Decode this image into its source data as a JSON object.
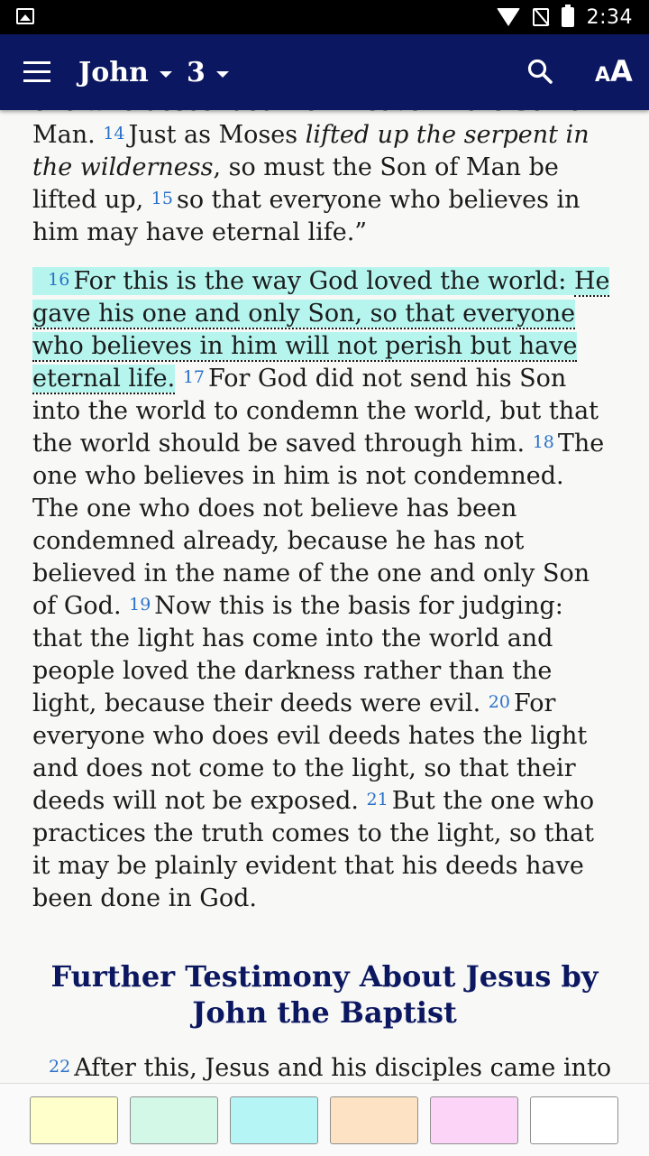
{
  "status_bar": {
    "time": "2:34"
  },
  "app_bar": {
    "book": "John",
    "chapter": "3"
  },
  "passage": {
    "top_line": "one who descended from heaven – the Son of",
    "p1": [
      {
        "text": "Man. "
      },
      {
        "verse": "14"
      },
      {
        "text": "Just as Moses "
      },
      {
        "italic": "lifted up the serpent in the wilderness"
      },
      {
        "text": ", so must the Son of Man be lifted up, "
      },
      {
        "verse": "15"
      },
      {
        "text": "so that everyone who believes in him may have eternal life.”"
      }
    ],
    "v16": "16",
    "v16_text": "For this is the way God loved the world: ",
    "v16_underlined": "He gave his one and only Son, so that everyone who believes in him will not perish but have eternal life.",
    "rest": [
      {
        "text": " "
      },
      {
        "verse": "17"
      },
      {
        "text": "For God did not send his Son into the world to condemn the world, but that the world should be saved through him. "
      },
      {
        "verse": "18"
      },
      {
        "text": "The one who believes in him is not condemned. The one who does not believe has been condemned already, because he has not believed in the name of the one and only Son of God. "
      },
      {
        "verse": "19"
      },
      {
        "text": "Now this is the basis for judging: that the light has come into the world and people loved the darkness rather than the light, because their deeds were evil. "
      },
      {
        "verse": "20"
      },
      {
        "text": "For everyone who does evil deeds hates the light and does not come to the light, so that their deeds will not be exposed. "
      },
      {
        "verse": "21"
      },
      {
        "text": "But the one who practices the truth comes to the light, so that it may be plainly evident that his deeds have been done in God."
      }
    ],
    "section_heading": "Further Testimony About Jesus by John the Baptist",
    "v22": "22",
    "v22_text": "After this, Jesus and his disciples came into Judean territory, and there he spent time with them and baptized."
  },
  "highlight_colors": [
    "#ffffcc",
    "#d4f8e8",
    "#b5f5f5",
    "#fde2c4",
    "#fcd4f8",
    "#ffffff"
  ],
  "colors": {
    "app_bar": "#0b1760",
    "verse_number": "#2a72c9",
    "highlight": "#b5f5ee"
  }
}
